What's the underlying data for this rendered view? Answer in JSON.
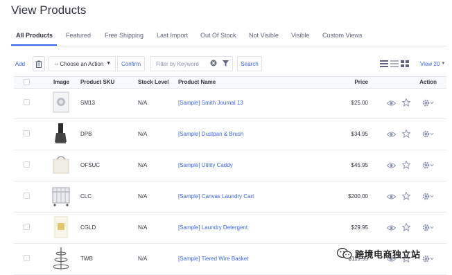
{
  "page": {
    "title": "View Products"
  },
  "tabs": [
    {
      "label": "All Products"
    },
    {
      "label": "Featured"
    },
    {
      "label": "Free Shipping"
    },
    {
      "label": "Last Import"
    },
    {
      "label": "Out Of Stock"
    },
    {
      "label": "Not Visible"
    },
    {
      "label": "Visible"
    },
    {
      "label": "Custom Views"
    }
  ],
  "toolbar": {
    "add_label": "Add",
    "action_select": "-- Choose an Action",
    "confirm_label": "Confirm",
    "filter_placeholder": "Filter by Keyword",
    "search_label": "Search",
    "view_label": "View 20"
  },
  "table": {
    "headers": {
      "image": "Image",
      "sku": "Product SKU",
      "stock": "Stock Level",
      "name": "Product Name",
      "price": "Price",
      "action": "Action"
    },
    "rows": [
      {
        "sku": "SM13",
        "stock": "N/A",
        "name": "[Sample] Smith Journal 13",
        "price": "$25.00"
      },
      {
        "sku": "DPB",
        "stock": "N/A",
        "name": "[Sample] Dustpan & Brush",
        "price": "$34.95"
      },
      {
        "sku": "OFSUC",
        "stock": "N/A",
        "name": "[Sample] Utility Caddy",
        "price": "$45.95"
      },
      {
        "sku": "CLC",
        "stock": "N/A",
        "name": "[Sample] Canvas Laundry Cart",
        "price": "$200.00"
      },
      {
        "sku": "CGLD",
        "stock": "N/A",
        "name": "[Sample] Laundry Detergent",
        "price": "$29.95"
      },
      {
        "sku": "TWB",
        "stock": "N/A",
        "name": "[Sample] Tiered Wire Basket",
        "price": "$119.95"
      }
    ]
  },
  "watermark": {
    "text": "跨境电商独立站"
  },
  "colors": {
    "accent": "#3c64f4",
    "text": "#313440",
    "muted": "#8c93ad"
  }
}
